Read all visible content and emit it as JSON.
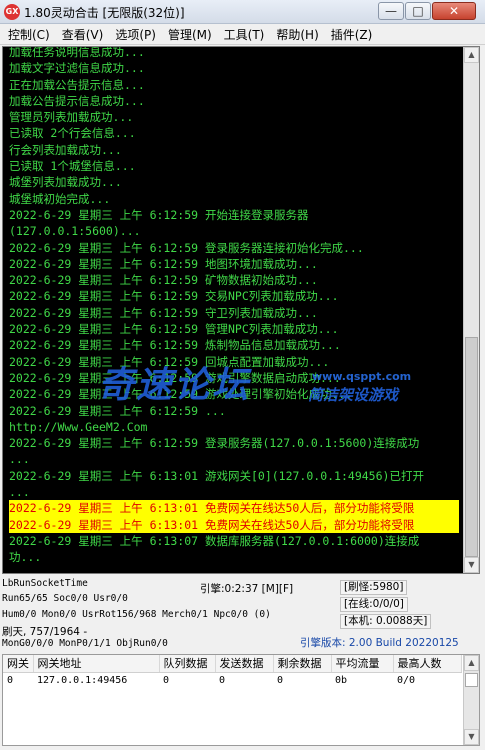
{
  "window": {
    "title": "1.80灵动合击 [无限版(32位)]",
    "icon_label": "GX",
    "minimize_glyph": "—",
    "maximize_glyph": "□",
    "close_glyph": "✕"
  },
  "menu": [
    {
      "label": "控制(C)"
    },
    {
      "label": "查看(V)"
    },
    {
      "label": "选项(P)"
    },
    {
      "label": "管理(M)"
    },
    {
      "label": "工具(T)"
    },
    {
      "label": "帮助(H)"
    },
    {
      "label": "插件(Z)"
    }
  ],
  "console": {
    "lines": [
      {
        "text": "加载任务说明信息成功...",
        "style": "green"
      },
      {
        "text": "加载文字过滤信息成功...",
        "style": "green"
      },
      {
        "text": "正在加载公告提示信息...",
        "style": "green"
      },
      {
        "text": "加载公告提示信息成功...",
        "style": "green"
      },
      {
        "text": "管理员列表加载成功...",
        "style": "green"
      },
      {
        "text": "已读取 2个行会信息...",
        "style": "green"
      },
      {
        "text": "行会列表加载成功...",
        "style": "green"
      },
      {
        "text": "已读取 1个城堡信息...",
        "style": "green"
      },
      {
        "text": "城堡列表加载成功...",
        "style": "green"
      },
      {
        "text": "城堡城初始完成...",
        "style": "green"
      },
      {
        "text": "2022-6-29 星期三 上午 6:12:59 开始连接登录服务器",
        "style": "green"
      },
      {
        "text": "(127.0.0.1:5600)...",
        "style": "green"
      },
      {
        "text": "2022-6-29 星期三 上午 6:12:59 登录服务器连接初始化完成...",
        "style": "green"
      },
      {
        "text": "2022-6-29 星期三 上午 6:12:59 地图环境加载成功...",
        "style": "green"
      },
      {
        "text": "2022-6-29 星期三 上午 6:12:59 矿物数据初始成功...",
        "style": "green"
      },
      {
        "text": "2022-6-29 星期三 上午 6:12:59 交易NPC列表加载成功...",
        "style": "green"
      },
      {
        "text": "2022-6-29 星期三 上午 6:12:59 守卫列表加载成功...",
        "style": "green"
      },
      {
        "text": "2022-6-29 星期三 上午 6:12:59 管理NPC列表加载成功...",
        "style": "green"
      },
      {
        "text": "2022-6-29 星期三 上午 6:12:59 炼制物品信息加载成功...",
        "style": "green"
      },
      {
        "text": "2022-6-29 星期三 上午 6:12:59 回城点配置加载成功...",
        "style": "green"
      },
      {
        "text": "2022-6-29 星期三 上午 6:12:59 游戏引擎数据启动成功...",
        "style": "green"
      },
      {
        "text": "2022-6-29 星期三 上午 6:12:59 游戏处理引擎初始化成功...",
        "style": "green"
      },
      {
        "text": "2022-6-29 星期三 上午 6:12:59 ...",
        "style": "green"
      },
      {
        "text": "http://Www.GeeM2.Com",
        "style": "green"
      },
      {
        "text": "2022-6-29 星期三 上午 6:12:59 登录服务器(127.0.0.1:5600)连接成功",
        "style": "green"
      },
      {
        "text": "...",
        "style": "green"
      },
      {
        "text": "2022-6-29 星期三 上午 6:13:01 游戏网关[0](127.0.0.1:49456)已打开",
        "style": "green"
      },
      {
        "text": "...",
        "style": "green"
      },
      {
        "text": "2022-6-29 星期三 上午 6:13:01 免费网关在线达50人后，部分功能将受限",
        "style": "highlight"
      },
      {
        "text": "2022-6-29 星期三 上午 6:13:01 免费网关在线达50人后，部分功能将受限",
        "style": "highlight"
      },
      {
        "text": "2022-6-29 星期三 上午 6:13:07 数据库服务器(127.0.0.1:6000)连接成",
        "style": "green"
      },
      {
        "text": "功...",
        "style": "green"
      }
    ]
  },
  "watermark": {
    "main": "奇速论坛",
    "url": "www.qsppt.com",
    "sub": "简洁架设游戏"
  },
  "status": {
    "socket_time": "LbRunSocketTime",
    "engine": "引擎:0:2:37 [M][F]",
    "refresh": "[刷怪:5980]",
    "run_line": "Run65/65 Soc0/0 Usr0/0",
    "online": "[在线:0/0/0]",
    "hum_line": "Hum0/0 Mon0/0 UsrRot156/968 Merch0/1 Npc0/0 (0)",
    "local": "[本机: 0.0088天]",
    "refresh_count": "刷天, 757/1964 -",
    "mon_line": "MonG0/0/0 MonP0/1/1 ObjRun0/0",
    "engine_version": "引擎版本: 2.00 Build 20220125"
  },
  "gateway_table": {
    "headers": [
      "网关",
      "网关地址",
      "队列数据",
      "发送数据",
      "剩余数据",
      "平均流量",
      "最高人数"
    ],
    "rows": [
      [
        "0",
        "127.0.0.1:49456",
        "0",
        "0",
        "0",
        "0b",
        "0/0"
      ]
    ]
  },
  "colors": {
    "console_bg": "#000000",
    "log_green": "#40d848",
    "highlight_bg": "#ffff00",
    "highlight_text": "#e00000",
    "watermark_blue": "#2060dc"
  }
}
